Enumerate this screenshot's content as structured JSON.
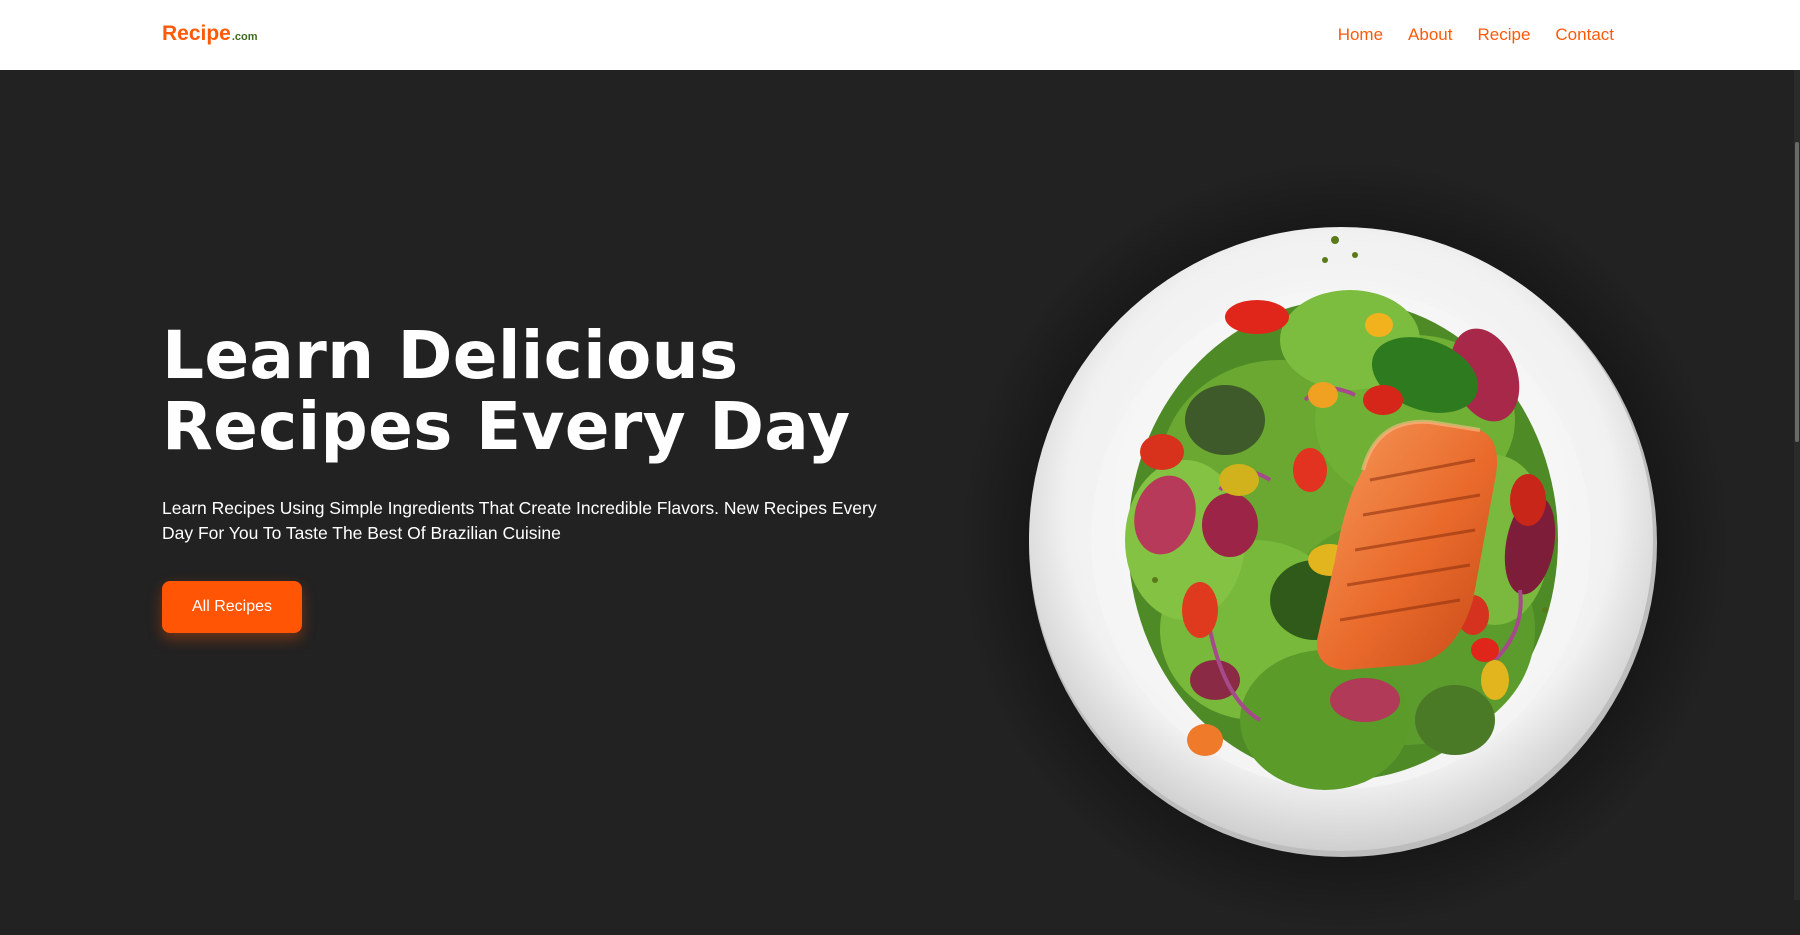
{
  "brand": {
    "name": "Recipe",
    "suffix": ".com"
  },
  "nav": {
    "items": [
      {
        "label": "Home"
      },
      {
        "label": "About"
      },
      {
        "label": "Recipe"
      },
      {
        "label": "Contact"
      }
    ]
  },
  "hero": {
    "title": "Learn Delicious Recipes Every Day",
    "subtitle": "Learn Recipes Using Simple Ingredients That Create Incredible Flavors. New Recipes Every Day For You To Taste The Best Of Brazilian Cuisine",
    "cta_label": "All Recipes",
    "image_icon": "salmon-salad-plate"
  },
  "colors": {
    "accent": "#ff5a0a",
    "brand_suffix": "#3d6b1f",
    "background": "#222222",
    "nav_background": "#ffffff"
  }
}
